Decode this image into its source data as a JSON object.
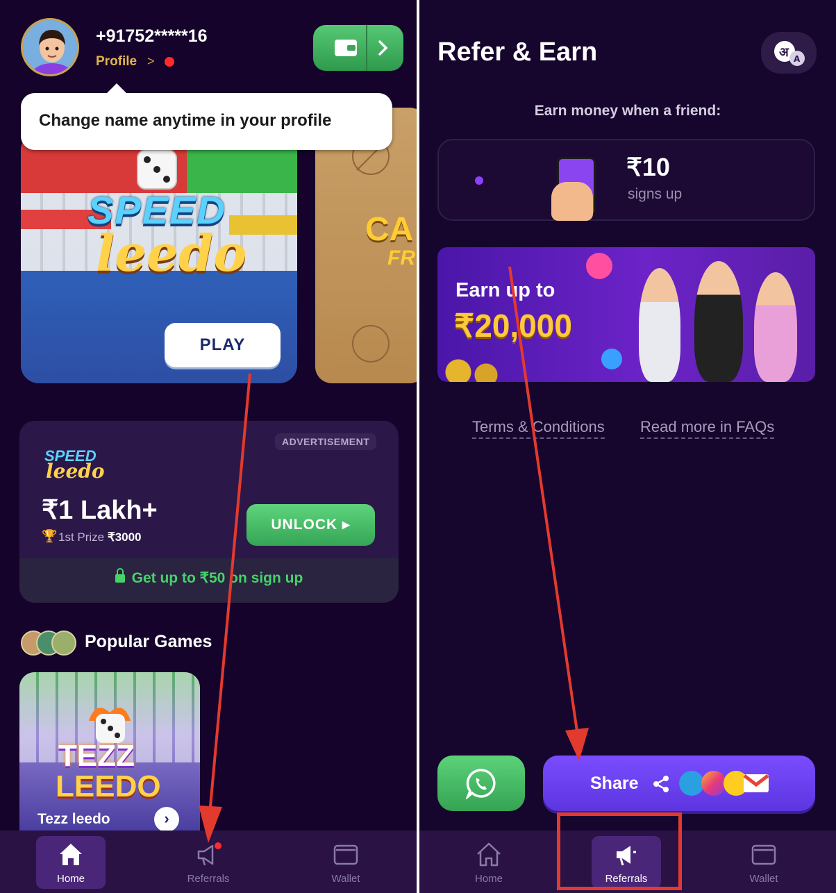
{
  "left": {
    "header": {
      "phone": "+91752*****16",
      "profile_label": "Profile",
      "profile_chevron": ">"
    },
    "tooltip": "Change name anytime in your profile",
    "featured": {
      "speed_logo_line1": "SPEED",
      "speed_logo_line2": "leedo",
      "play_label": "PLAY",
      "carrom_line1": "CA",
      "carrom_line2": "FR"
    },
    "ad": {
      "label": "ADVERTISEMENT",
      "logo_line1": "SPEED",
      "logo_line2": "leedo",
      "amount": "₹1 Lakh+",
      "prize_prefix": "1st Prize",
      "prize_value": "₹3000",
      "unlock_label": "UNLOCK ▸",
      "offer": "Get up to ₹50 on sign up"
    },
    "popular": {
      "title": "Popular Games",
      "game_logo_line1": "TEZZ",
      "game_logo_line2": "LEEDO",
      "game_name": "Tezz leedo"
    },
    "nav": [
      {
        "label": "Home",
        "icon": "home-icon",
        "active": true
      },
      {
        "label": "Referrals",
        "icon": "megaphone-icon",
        "active": false
      },
      {
        "label": "Wallet",
        "icon": "wallet-icon",
        "active": false
      }
    ]
  },
  "right": {
    "title": "Refer & Earn",
    "language_icon": "language-toggle-icon",
    "subtitle": "Earn money when a friend:",
    "reward": {
      "amount": "₹10",
      "condition": "signs up"
    },
    "banner": {
      "line1": "Earn up to",
      "line2": "₹20,000"
    },
    "links": {
      "terms": "Terms & Conditions",
      "faq": "Read more in FAQs"
    },
    "share_label": "Share",
    "nav": [
      {
        "label": "Home",
        "icon": "home-icon",
        "active": false
      },
      {
        "label": "Referrals",
        "icon": "megaphone-icon",
        "active": true
      },
      {
        "label": "Wallet",
        "icon": "wallet-icon",
        "active": false
      }
    ]
  },
  "colors": {
    "background": "#15032b",
    "accent_green": "#45d368",
    "accent_purple": "#6c3df0",
    "annotation_red": "#e33a2e",
    "gold": "#ffc93b"
  }
}
